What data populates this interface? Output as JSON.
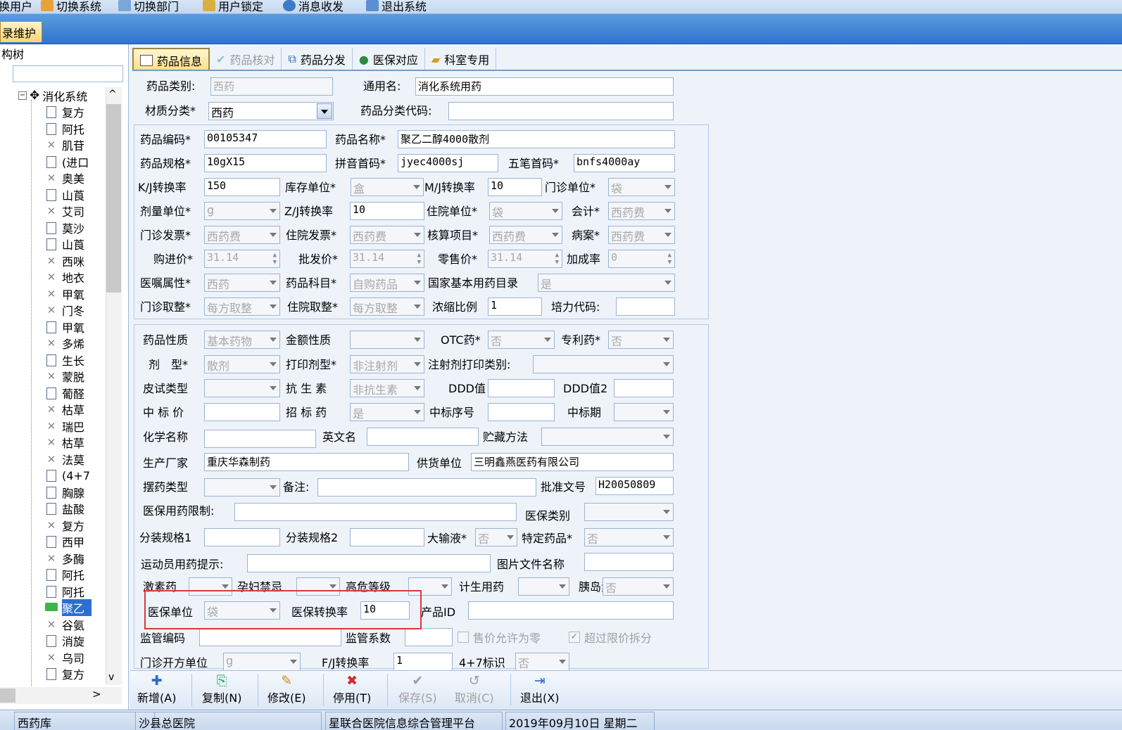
{
  "menubar": {
    "items": [
      {
        "label": "换用户",
        "icon": "user-switch-icon"
      },
      {
        "label": "切换系统",
        "icon": "system-switch-icon"
      },
      {
        "label": "切换部门",
        "icon": "department-switch-icon"
      },
      {
        "label": "用户锁定",
        "icon": "lock-icon"
      },
      {
        "label": "消息收发",
        "icon": "message-icon"
      },
      {
        "label": "退出系统",
        "icon": "exit-icon"
      }
    ]
  },
  "window_tab": "录维护",
  "tree": {
    "title": "构树",
    "root": "消化系统",
    "items": [
      {
        "label": "复方",
        "status": "active"
      },
      {
        "label": "阿托",
        "status": "active"
      },
      {
        "label": "肌苷",
        "status": "disabled"
      },
      {
        "label": "(进口",
        "status": "active"
      },
      {
        "label": "奥美",
        "status": "disabled"
      },
      {
        "label": "山莨",
        "status": "active"
      },
      {
        "label": "艾司",
        "status": "disabled"
      },
      {
        "label": "莫沙",
        "status": "active"
      },
      {
        "label": "山莨",
        "status": "active"
      },
      {
        "label": "西咪",
        "status": "disabled"
      },
      {
        "label": "地衣",
        "status": "disabled"
      },
      {
        "label": "甲氧",
        "status": "disabled"
      },
      {
        "label": "门冬",
        "status": "disabled"
      },
      {
        "label": "甲氧",
        "status": "active"
      },
      {
        "label": "多烯",
        "status": "disabled"
      },
      {
        "label": "生长",
        "status": "active"
      },
      {
        "label": "蒙脱",
        "status": "disabled"
      },
      {
        "label": "葡醛",
        "status": "active"
      },
      {
        "label": "枯草",
        "status": "disabled"
      },
      {
        "label": "瑞巴",
        "status": "disabled"
      },
      {
        "label": "枯草",
        "status": "disabled"
      },
      {
        "label": "法莫",
        "status": "disabled"
      },
      {
        "label": "(4+7",
        "status": "active"
      },
      {
        "label": "胸腺",
        "status": "active"
      },
      {
        "label": "盐酸",
        "status": "active"
      },
      {
        "label": "复方",
        "status": "disabled"
      },
      {
        "label": "西甲",
        "status": "active"
      },
      {
        "label": "多酶",
        "status": "disabled"
      },
      {
        "label": "阿托",
        "status": "active"
      },
      {
        "label": "阿托",
        "status": "active"
      },
      {
        "label": "聚乙",
        "status": "selected"
      },
      {
        "label": "谷氨",
        "status": "disabled"
      },
      {
        "label": "消旋",
        "status": "active"
      },
      {
        "label": "乌司",
        "status": "disabled"
      },
      {
        "label": "复方",
        "status": "active"
      }
    ]
  },
  "tabs": [
    {
      "label": "药品信息",
      "state": "active"
    },
    {
      "label": "药品核对",
      "state": "disabled"
    },
    {
      "label": "药品分发",
      "state": "normal"
    },
    {
      "label": "医保对应",
      "state": "normal"
    },
    {
      "label": "科室专用",
      "state": "normal"
    }
  ],
  "form": {
    "drug_category_label": "药品类别:",
    "drug_category": "西药",
    "generic_name_label": "通用名:",
    "generic_name": "消化系统用药",
    "material_class_label": "材质分类*",
    "material_class": "西药",
    "class_code_label": "药品分类代码:",
    "class_code": "",
    "drug_code_label": "药品编码*",
    "drug_code": "00105347",
    "drug_name_label": "药品名称*",
    "drug_name": "聚乙二醇4000散剂",
    "spec_label": "药品规格*",
    "spec": "10gX15",
    "pinyin_label": "拼音首码*",
    "pinyin": "jyec4000sj",
    "wubi_label": "五笔首码*",
    "wubi": "bnfs4000ay",
    "kj_rate_label": "K/J转换率",
    "kj_rate": "150",
    "stock_unit_label": "库存单位*",
    "stock_unit": "盒",
    "mj_rate_label": "M/J转换率",
    "mj_rate": "10",
    "outpatient_unit_label": "门诊单位*",
    "outpatient_unit": "袋",
    "dose_unit_label": "剂量单位*",
    "dose_unit": "g",
    "zj_rate_label": "Z/J转换率",
    "zj_rate": "10",
    "inpatient_unit_label": "住院单位*",
    "inpatient_unit": "袋",
    "accounting_label": "会计*",
    "accounting": "西药费",
    "op_invoice_label": "门诊发票*",
    "op_invoice": "西药费",
    "ip_invoice_label": "住院发票*",
    "ip_invoice": "西药费",
    "account_item_label": "核算项目*",
    "account_item": "西药费",
    "case_label": "病案*",
    "case": "西药费",
    "purchase_price_label": "购进价*",
    "purchase_price": "31.14",
    "wholesale_price_label": "批发价*",
    "wholesale_price": "31.14",
    "retail_price_label": "零售价*",
    "retail_price": "31.14",
    "markup_label": "加成率",
    "markup": "0",
    "order_attr_label": "医嘱属性*",
    "order_attr": "西药",
    "drug_subject_label": "药品科目*",
    "drug_subject": "自购药品",
    "essential_list_label": "国家基本用药目录",
    "essential_list": "是",
    "op_rounding_label": "门诊取整*",
    "op_rounding": "每方取整",
    "ip_rounding_label": "住院取整*",
    "ip_rounding": "每方取整",
    "concentration_label": "浓缩比例",
    "concentration": "1",
    "peili_code_label": "培力代码:",
    "peili_code": "",
    "nature_label": "药品性质",
    "nature": "基本药物",
    "amount_nature_label": "金额性质",
    "amount_nature": "",
    "otc_label": "OTC药*",
    "otc": "否",
    "patent_label": "专利药*",
    "patent": "否",
    "dosage_form_label": "剂　型*",
    "dosage_form": "散剂",
    "print_form_label": "打印剂型*",
    "print_form": "非注射剂",
    "injection_print_label": "注射剂打印类别:",
    "injection_print": "",
    "skin_test_label": "皮试类型",
    "skin_test": "",
    "antibiotic_label": "抗 生 素",
    "antibiotic": "非抗生素",
    "ddd_label": "DDD值",
    "ddd": "",
    "ddd2_label": "DDD值2",
    "ddd2": "",
    "bid_price_label": "中 标 价",
    "bid_price": "",
    "bid_drug_label": "招 标 药",
    "bid_drug": "是",
    "bid_no_label": "中标序号",
    "bid_no": "",
    "bid_period_label": "中标期",
    "bid_period": "",
    "chem_name_label": "化学名称",
    "chem_name": "",
    "eng_name_label": "英文名",
    "eng_name": "",
    "storage_label": "贮藏方法",
    "storage": "",
    "manufacturer_label": "生产厂家",
    "manufacturer": "重庆华森制药",
    "supplier_label": "供货单位",
    "supplier": "三明鑫燕医药有限公司",
    "placement_label": "摆药类型",
    "placement": "",
    "remark_label": "备注:",
    "remark": "",
    "approval_label": "批准文号",
    "approval": "H20050809",
    "insurance_limit_label": "医保用药限制:",
    "insurance_limit": "",
    "insurance_type_label": "医保类别",
    "insurance_type": "",
    "pack_spec1_label": "分装规格1",
    "pack_spec1": "",
    "pack_spec2_label": "分装规格2",
    "pack_spec2": "",
    "infusion_label": "大输液*",
    "infusion": "否",
    "special_label": "特定药品*",
    "special": "否",
    "athlete_label": "运动员用药提示:",
    "athlete": "",
    "image_file_label": "图片文件名称",
    "image_file": "",
    "hormone_label": "激素药",
    "hormone": "",
    "pregnancy_label": "孕妇禁忌",
    "pregnancy": "",
    "risk_label": "高危等级",
    "risk": "",
    "family_plan_label": "计生用药",
    "family_plan": "",
    "insulin_label": "胰岛素",
    "insulin": "否",
    "ins_unit_label": "医保单位",
    "ins_unit": "袋",
    "ins_rate_label": "医保转换率",
    "ins_rate": "10",
    "product_id_label": "产品ID",
    "product_id": "",
    "regulator_code_label": "监管编码",
    "regulator_code": "",
    "regulator_factor_label": "监管系数",
    "regulator_factor": "",
    "zero_price_label": "售价允许为零",
    "split_label": "超过限价拆分",
    "op_rx_unit_label": "门诊开方单位",
    "op_rx_unit": "g",
    "fj_rate_label": "F/J转换率",
    "fj_rate": "1",
    "flag47_label": "4+7标识",
    "flag47": "否"
  },
  "toolbar": {
    "add": "新增(A)",
    "copy": "复制(N)",
    "edit": "修改(E)",
    "disable": "停用(T)",
    "save": "保存(S)",
    "cancel": "取消(C)",
    "exit": "退出(X)"
  },
  "statusbar": [
    "西药库",
    "沙县总医院",
    "星联合医院信息综合管理平台",
    "2019年09月10日 星期二"
  ]
}
